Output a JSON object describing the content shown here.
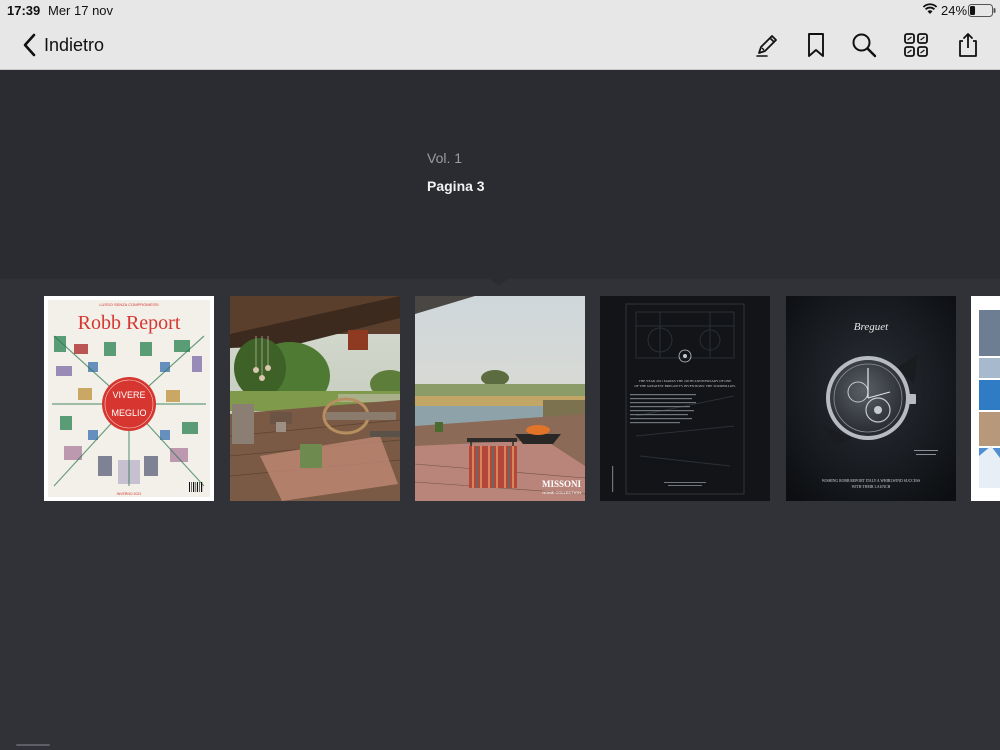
{
  "status_bar": {
    "time": "17:39",
    "date": "Mer 17 nov",
    "battery_percent": "24%",
    "battery_level": 0.24
  },
  "nav": {
    "back_label": "Indietro",
    "icons": [
      "pencil-icon",
      "bookmark-icon",
      "search-icon",
      "grid-icon",
      "share-icon"
    ]
  },
  "info": {
    "volume": "Vol. 1",
    "page": "Pagina 3"
  },
  "thumbnails": [
    {
      "name": "cover",
      "brand": "Robb Report",
      "headline_1": "VIVERE",
      "headline_2": "MEGLIO",
      "top_line": "LUSSO SENZA COMPROMESSI",
      "bottom_line": "INVERNO 2021"
    },
    {
      "name": "outdoor-terrace"
    },
    {
      "name": "missoni-ad",
      "brand": "MISSONI",
      "subline": "HOME COLLECTION"
    },
    {
      "name": "breguet-anniversary",
      "text_1": "THE YEAR 2021 MARKS THE 220TH ANNIVERSARY OF ONE",
      "text_2": "OF THE GREATEST BREGUET'S INVENTIONS: THE TOURBILLON."
    },
    {
      "name": "breguet-watch",
      "brand": "Breguet",
      "caption_1": "WISHING ROBB REPORT ITALY A WHIRLWIND SUCCESS",
      "caption_2": "WITH THEIR LAUNCH"
    },
    {
      "name": "partial-page"
    }
  ],
  "colors": {
    "bar_bg": "#e7e7e7",
    "panel_bg": "#2a2c31",
    "strip_bg": "#303237",
    "robb_red": "#d6362f"
  }
}
